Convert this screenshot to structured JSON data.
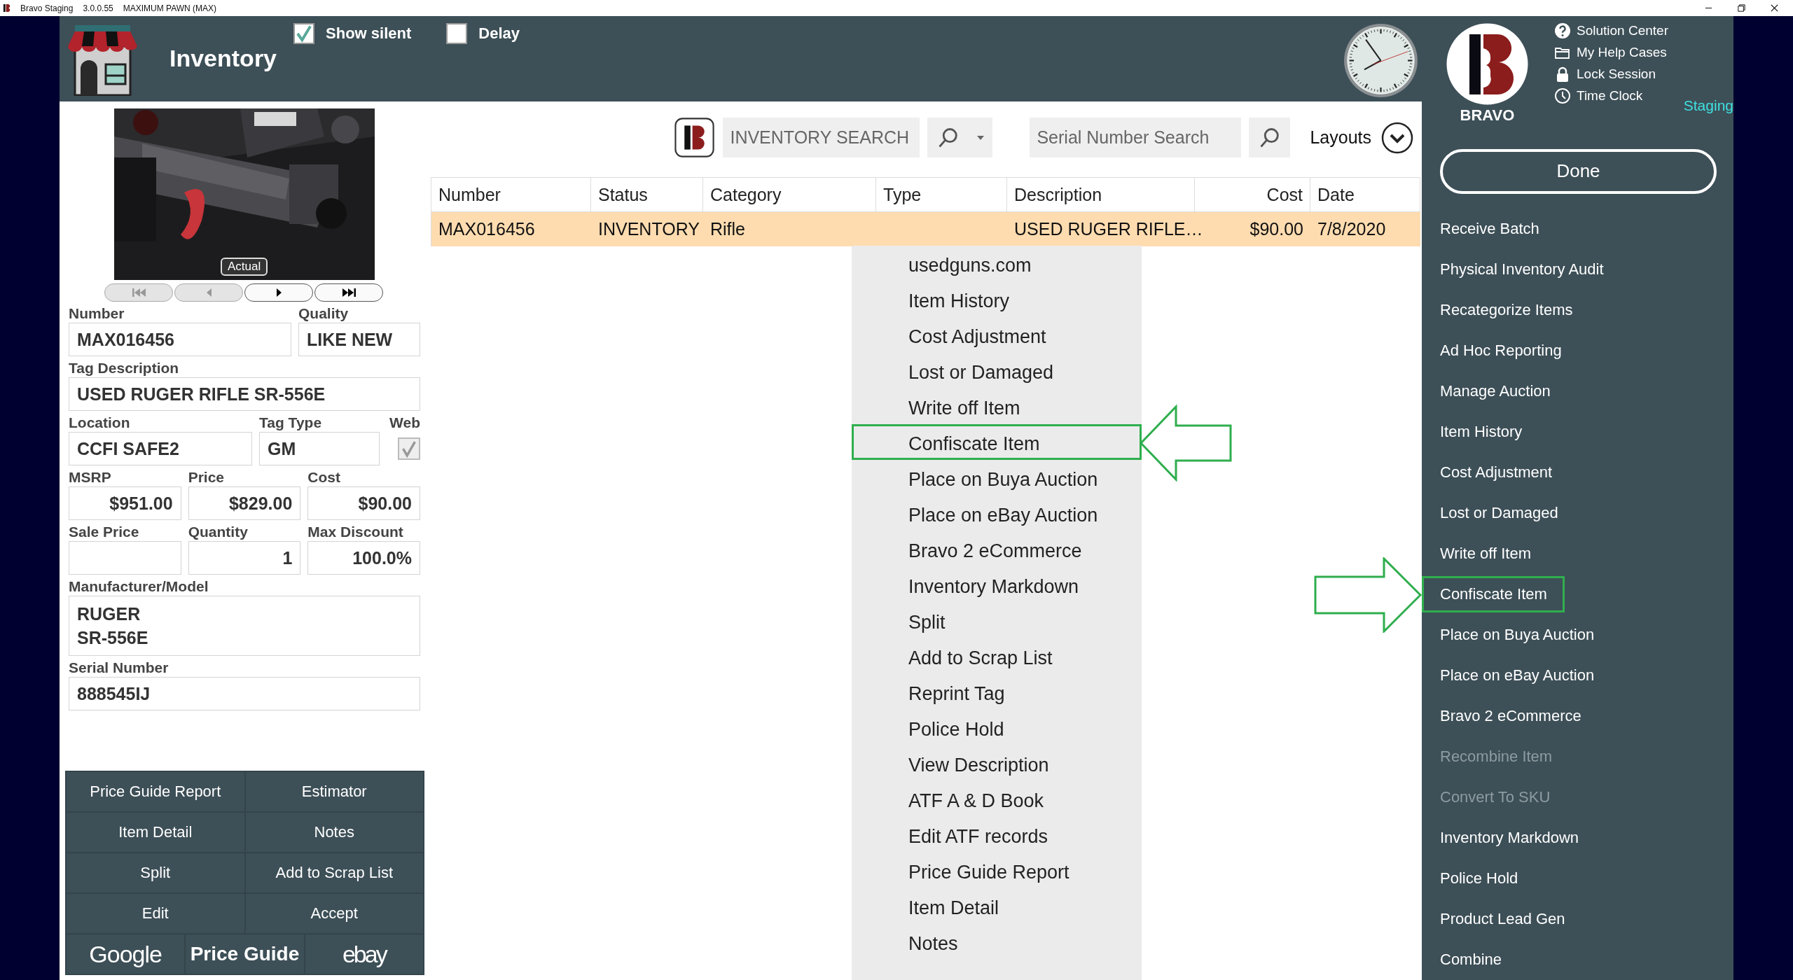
{
  "title_bar": {
    "app": "Bravo Staging",
    "version": "3.0.0.55",
    "store": "MAXIMUM PAWN (MAX)"
  },
  "header": {
    "title": "Inventory",
    "options": [
      {
        "label": "Show silent",
        "checked": true
      },
      {
        "label": "Delay",
        "checked": false
      }
    ]
  },
  "brand": {
    "name": "BRAVO",
    "environment": "Staging",
    "links": [
      {
        "label": "Solution Center",
        "kind": "help"
      },
      {
        "label": "My Help Cases",
        "kind": "folder"
      },
      {
        "label": "Lock Session",
        "kind": "lock"
      },
      {
        "label": "Time Clock",
        "kind": "clock"
      }
    ]
  },
  "photo": {
    "kind": "picture",
    "badge": "Actual"
  },
  "photo_nav": [
    {
      "kind": "first",
      "disabled": true
    },
    {
      "kind": "prev",
      "disabled": true
    },
    {
      "kind": "next",
      "disabled": false
    },
    {
      "kind": "last",
      "disabled": false
    }
  ],
  "item_form": [
    [
      {
        "kind": "text",
        "label": "Number",
        "value": "MAX016456"
      },
      {
        "kind": "text",
        "label": "Quality",
        "value": "LIKE NEW"
      }
    ],
    [
      {
        "kind": "text",
        "label": "Tag Description",
        "value": "USED RUGER RIFLE SR-556E"
      }
    ],
    [
      {
        "kind": "text",
        "label": "Location",
        "value": "CCFI SAFE2"
      },
      {
        "kind": "text",
        "label": "Tag Type",
        "value": "GM"
      },
      {
        "kind": "checkbox",
        "label": "Web",
        "checked": true,
        "disabled": true
      }
    ],
    [
      {
        "kind": "amount",
        "label": "MSRP",
        "value": "$951.00"
      },
      {
        "kind": "amount",
        "label": "Price",
        "value": "$829.00"
      },
      {
        "kind": "amount",
        "label": "Cost",
        "value": "$90.00"
      }
    ],
    [
      {
        "kind": "amount",
        "label": "Sale Price"
      },
      {
        "kind": "amount",
        "label": "Quantity",
        "value": "1"
      },
      {
        "kind": "amount",
        "label": "Max Discount",
        "value": "100.0%"
      }
    ],
    [
      {
        "kind": "multiline",
        "label": "Manufacturer/Model",
        "value": "RUGER\nSR-556E"
      }
    ],
    [
      {
        "kind": "text",
        "label": "Serial Number",
        "value": "888545IJ"
      }
    ]
  ],
  "action_buttons": [
    "Price Guide Report",
    "Estimator",
    "Item Detail",
    "Notes",
    "Split",
    "Add to Scrap List",
    "Edit",
    "Accept"
  ],
  "lookup_buttons": [
    {
      "label": "Google",
      "kind": "google"
    },
    {
      "label": "Price Guide",
      "kind": "plain"
    },
    {
      "label": "ebay",
      "kind": "ebay"
    }
  ],
  "toolbar": {
    "inventory_search": {
      "placeholder": "INVENTORY SEARCH"
    },
    "serial_search": {
      "placeholder": "Serial Number Search"
    },
    "layouts": "Layouts"
  },
  "table": {
    "columns": [
      {
        "label": "Number",
        "kind": "text"
      },
      {
        "label": "Status",
        "kind": "text"
      },
      {
        "label": "Category",
        "kind": "text"
      },
      {
        "label": "Type",
        "kind": "text"
      },
      {
        "label": "Description",
        "kind": "text"
      },
      {
        "label": "Cost",
        "kind": "money"
      },
      {
        "label": "Date",
        "kind": "text"
      }
    ],
    "rows": [
      {
        "selected": true,
        "cells": [
          "MAX016456",
          "INVENTORY",
          "Rifle",
          null,
          "USED RUGER RIFLE…",
          "$90.00",
          "7/8/2020"
        ]
      }
    ]
  },
  "context_menu": {
    "items": [
      {
        "label": "usedguns.com",
        "highlighted": false
      },
      {
        "label": "Item History",
        "highlighted": false
      },
      {
        "label": "Cost Adjustment",
        "highlighted": false
      },
      {
        "label": "Lost or Damaged",
        "highlighted": false
      },
      {
        "label": "Write off Item",
        "highlighted": false
      },
      {
        "label": "Confiscate Item",
        "highlighted": true
      },
      {
        "label": "Place on Buya Auction",
        "highlighted": false
      },
      {
        "label": "Place on eBay Auction",
        "highlighted": false
      },
      {
        "label": "Bravo 2 eCommerce",
        "highlighted": false
      },
      {
        "label": "Inventory Markdown",
        "highlighted": false
      },
      {
        "label": "Split",
        "highlighted": false
      },
      {
        "label": "Add to Scrap List",
        "highlighted": false
      },
      {
        "label": "Reprint Tag",
        "highlighted": false
      },
      {
        "label": "Police Hold",
        "highlighted": false
      },
      {
        "label": "View Description",
        "highlighted": false
      },
      {
        "label": "ATF A & D Book",
        "highlighted": false
      },
      {
        "label": "Edit ATF records",
        "highlighted": false
      },
      {
        "label": "Price Guide Report",
        "highlighted": false
      },
      {
        "label": "Item Detail",
        "highlighted": false
      },
      {
        "label": "Notes",
        "highlighted": false
      }
    ]
  },
  "sidebar": {
    "done": "Done",
    "items": [
      {
        "label": "Receive Batch",
        "disabled": false,
        "highlighted": false
      },
      {
        "label": "Physical Inventory Audit",
        "disabled": false,
        "highlighted": false
      },
      {
        "label": "Recategorize Items",
        "disabled": false,
        "highlighted": false
      },
      {
        "label": "Ad Hoc Reporting",
        "disabled": false,
        "highlighted": false
      },
      {
        "label": "Manage Auction",
        "disabled": false,
        "highlighted": false
      },
      {
        "label": "Item History",
        "disabled": false,
        "highlighted": false
      },
      {
        "label": "Cost Adjustment",
        "disabled": false,
        "highlighted": false
      },
      {
        "label": "Lost or Damaged",
        "disabled": false,
        "highlighted": false
      },
      {
        "label": "Write off Item",
        "disabled": false,
        "highlighted": false
      },
      {
        "label": "Confiscate Item",
        "disabled": false,
        "highlighted": true
      },
      {
        "label": "Place on Buya Auction",
        "disabled": false,
        "highlighted": false
      },
      {
        "label": "Place on eBay Auction",
        "disabled": false,
        "highlighted": false
      },
      {
        "label": "Bravo 2 eCommerce",
        "disabled": false,
        "highlighted": false
      },
      {
        "label": "Recombine Item",
        "disabled": true,
        "highlighted": false
      },
      {
        "label": "Convert To SKU",
        "disabled": true,
        "highlighted": false
      },
      {
        "label": "Inventory Markdown",
        "disabled": false,
        "highlighted": false
      },
      {
        "label": "Police Hold",
        "disabled": false,
        "highlighted": false
      },
      {
        "label": "Product Lead Gen",
        "disabled": false,
        "highlighted": false
      },
      {
        "label": "Combine",
        "disabled": false,
        "highlighted": false
      }
    ]
  }
}
